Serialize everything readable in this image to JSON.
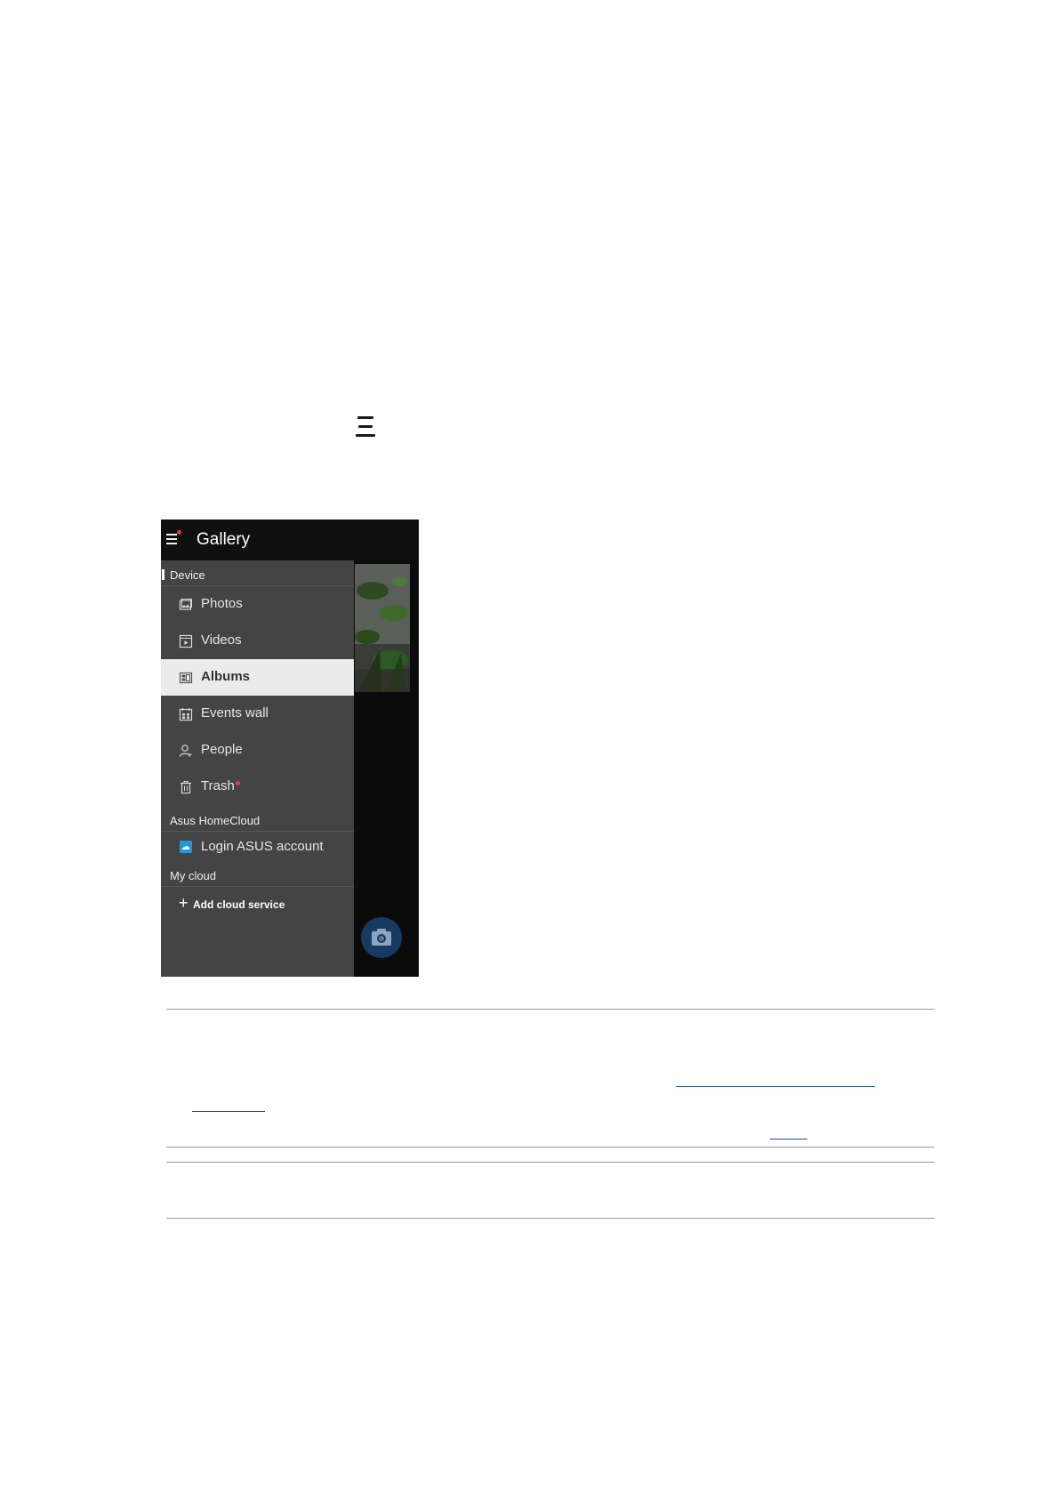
{
  "gallery": {
    "title": "Gallery",
    "sections": {
      "device": "Device",
      "homecloud": "Asus HomeCloud",
      "mycloud": "My cloud"
    },
    "items": [
      {
        "label": "Photos",
        "icon": "photos-icon"
      },
      {
        "label": "Videos",
        "icon": "videos-icon"
      },
      {
        "label": "Albums",
        "icon": "albums-icon",
        "selected": true
      },
      {
        "label": "Events wall",
        "icon": "events-wall-icon"
      },
      {
        "label": "People",
        "icon": "people-icon"
      },
      {
        "label": "Trash",
        "icon": "trash-icon",
        "badge": true
      }
    ],
    "login_label": "Login ASUS account",
    "add_cloud_label": "Add cloud service"
  },
  "colors": {
    "drawer_bg": "#444444",
    "selected_bg": "#ebebeb",
    "titlebar_bg": "#0f0f0f",
    "badge": "#e53935",
    "fab": "#163a62",
    "link": "#1f4e96"
  }
}
